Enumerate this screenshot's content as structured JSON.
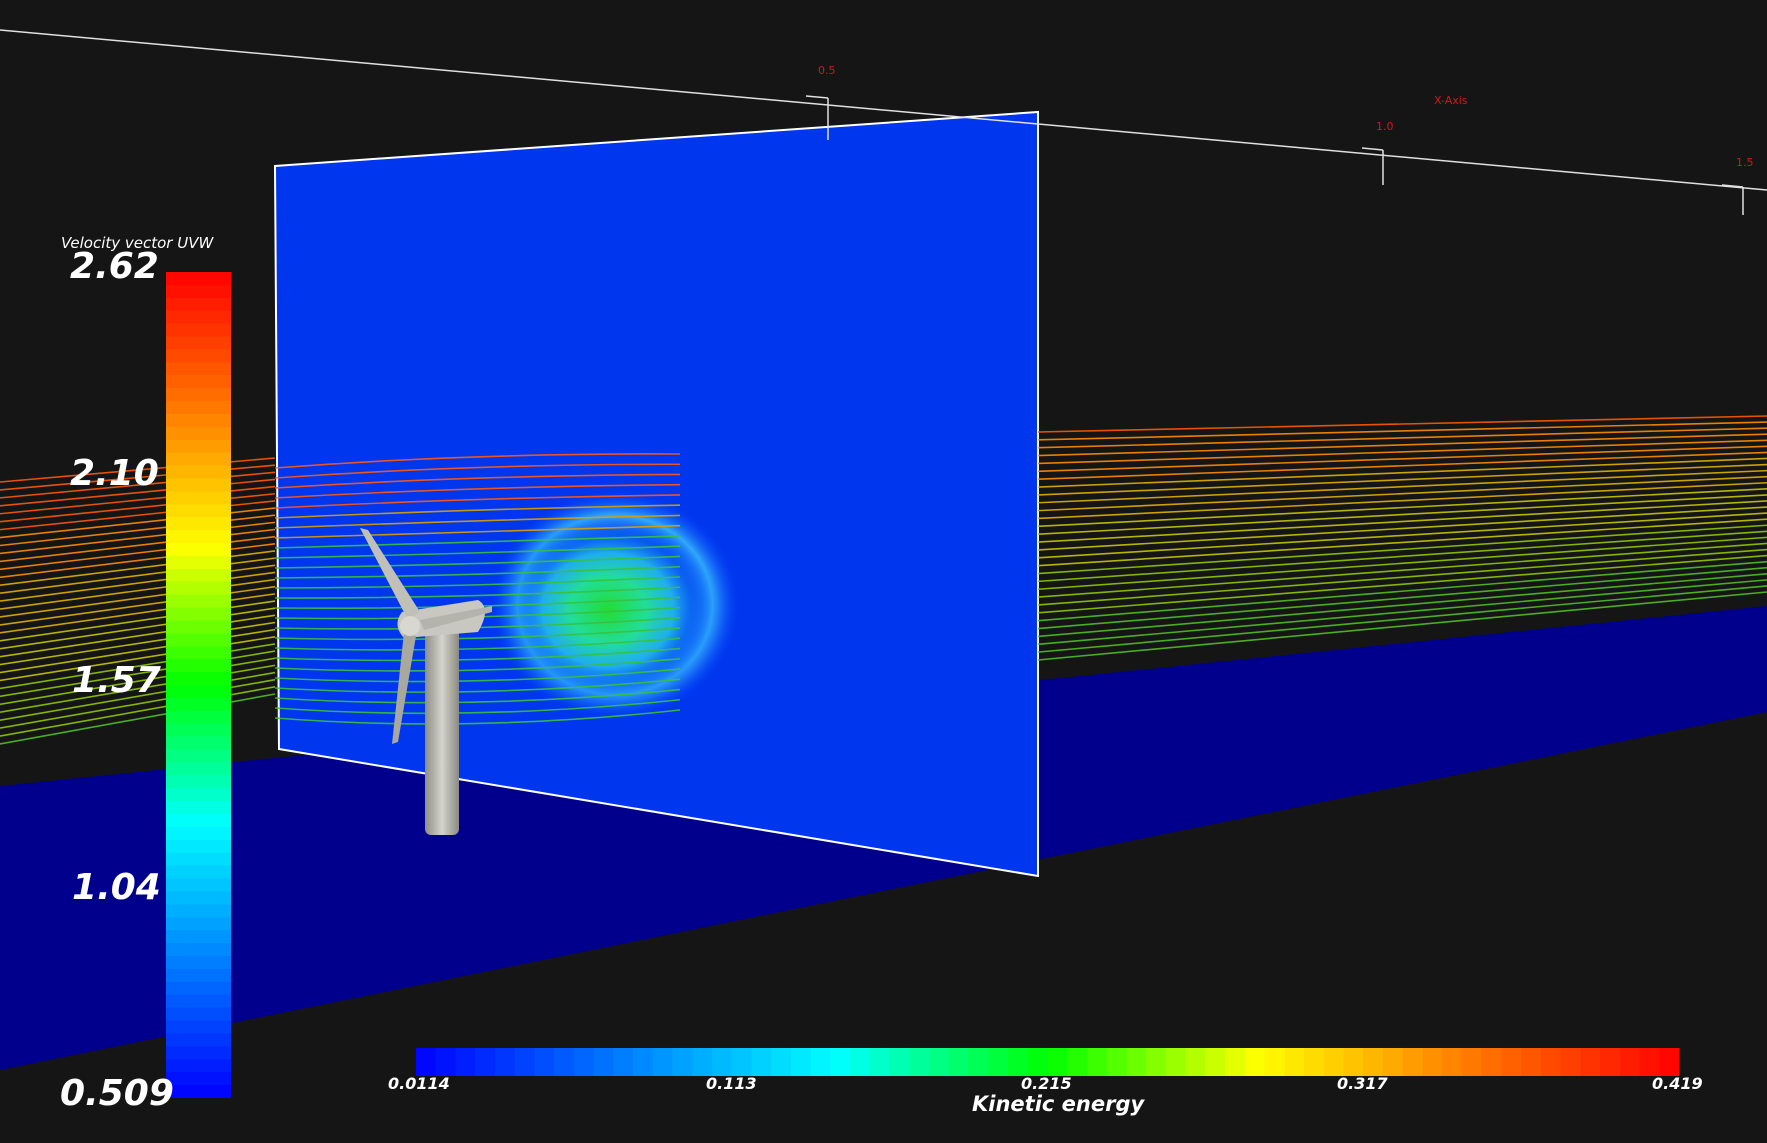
{
  "axis": {
    "title": "X-Axis",
    "ticks": [
      "0.5",
      "1.0",
      "1.5"
    ]
  },
  "velocity_legend": {
    "title": "Velocity vector UVW",
    "labels": [
      "2.62",
      "2.10",
      "1.57",
      "1.04",
      "0.509"
    ],
    "colors": [
      "#ff0000",
      "#ff7a00",
      "#ffff00",
      "#00ff00",
      "#00ffff",
      "#0080ff",
      "#0000ff"
    ]
  },
  "energy_legend": {
    "title": "Kinetic energy",
    "labels": [
      "0.0114",
      "0.113",
      "0.215",
      "0.317",
      "0.419"
    ],
    "colors": [
      "#0000ff",
      "#0080ff",
      "#00ffff",
      "#00ff00",
      "#ffff00",
      "#ff7a00",
      "#ff0000"
    ]
  },
  "scene": {
    "background": "#151515",
    "ground_color": "#00008c",
    "slice_color": "#0033ee",
    "turbine_color": "#b8b8b0"
  }
}
